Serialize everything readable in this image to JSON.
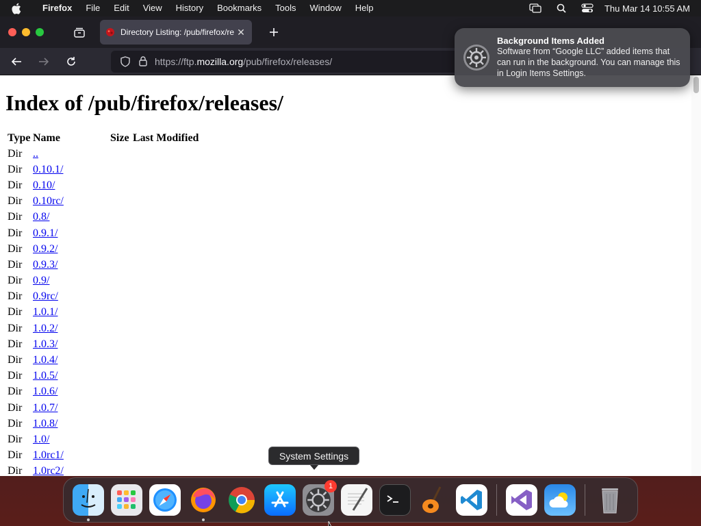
{
  "menubar": {
    "app_name": "Firefox",
    "items": [
      "File",
      "Edit",
      "View",
      "History",
      "Bookmarks",
      "Tools",
      "Window",
      "Help"
    ],
    "clock": "Thu Mar 14  10:55 AM"
  },
  "browser": {
    "tab_title": "Directory Listing: /pub/firefox/re",
    "url_prefix": "https://ftp.",
    "url_host": "mozilla.org",
    "url_path": "/pub/firefox/releases/"
  },
  "page": {
    "heading": "Index of /pub/firefox/releases/",
    "columns": [
      "Type",
      "Name",
      "Size",
      "Last Modified"
    ],
    "rows": [
      {
        "type": "Dir",
        "name": ".."
      },
      {
        "type": "Dir",
        "name": "0.10.1/"
      },
      {
        "type": "Dir",
        "name": "0.10/"
      },
      {
        "type": "Dir",
        "name": "0.10rc/"
      },
      {
        "type": "Dir",
        "name": "0.8/"
      },
      {
        "type": "Dir",
        "name": "0.9.1/"
      },
      {
        "type": "Dir",
        "name": "0.9.2/"
      },
      {
        "type": "Dir",
        "name": "0.9.3/"
      },
      {
        "type": "Dir",
        "name": "0.9/"
      },
      {
        "type": "Dir",
        "name": "0.9rc/"
      },
      {
        "type": "Dir",
        "name": "1.0.1/"
      },
      {
        "type": "Dir",
        "name": "1.0.2/"
      },
      {
        "type": "Dir",
        "name": "1.0.3/"
      },
      {
        "type": "Dir",
        "name": "1.0.4/"
      },
      {
        "type": "Dir",
        "name": "1.0.5/"
      },
      {
        "type": "Dir",
        "name": "1.0.6/"
      },
      {
        "type": "Dir",
        "name": "1.0.7/"
      },
      {
        "type": "Dir",
        "name": "1.0.8/"
      },
      {
        "type": "Dir",
        "name": "1.0/"
      },
      {
        "type": "Dir",
        "name": "1.0rc1/"
      },
      {
        "type": "Dir",
        "name": "1.0rc2/"
      }
    ]
  },
  "notification": {
    "title": "Background Items Added",
    "body": "Software from “Google LLC” added items that can run in the background. You can manage this in Login Items Settings."
  },
  "dock": {
    "tooltip": "System Settings",
    "settings_badge": "1",
    "items": [
      "finder",
      "launchpad",
      "safari",
      "firefox",
      "chrome",
      "app-store",
      "system-settings",
      "textedit",
      "terminal",
      "garageband",
      "vscode",
      "visual-studio",
      "weather",
      "trash"
    ]
  },
  "colors": {
    "link": "#0000ee",
    "tab_bg": "#42414d",
    "toolbar_bg": "#2b2a33",
    "badge": "#ff3b30"
  }
}
